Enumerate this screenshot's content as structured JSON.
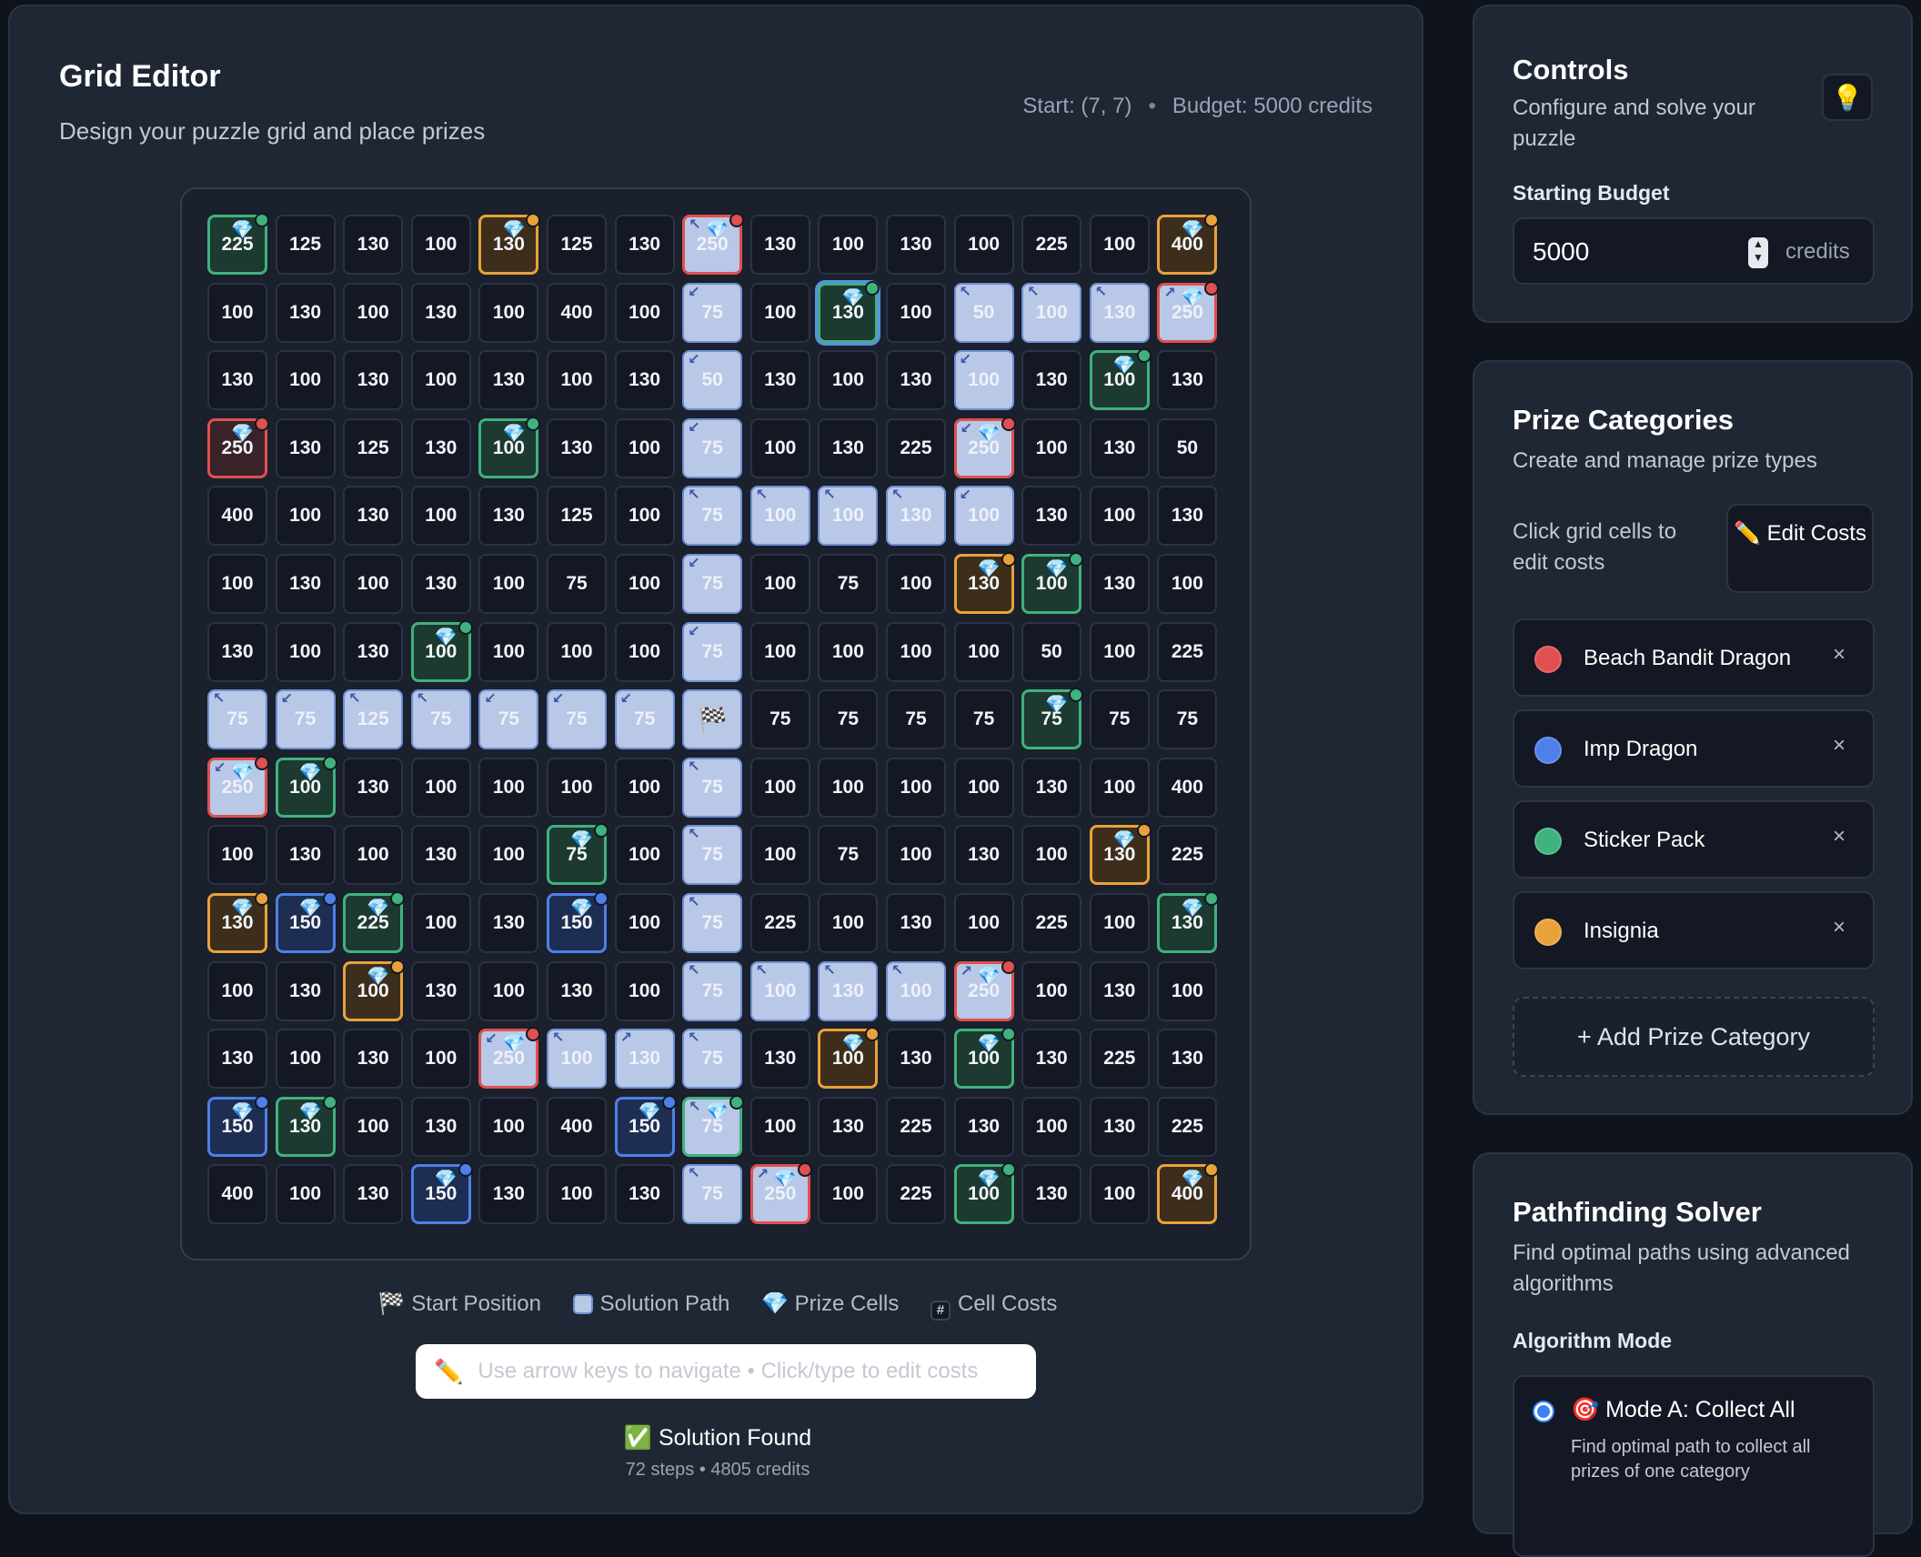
{
  "editor": {
    "title": "Grid Editor",
    "subtitle": "Design your puzzle grid and place prizes",
    "start_label": "Start: (7, 7)",
    "sep": "•",
    "budget_label": "Budget: 5000 credits"
  },
  "colors": {
    "red": "#e0504f",
    "blue": "#4f7fe8",
    "green": "#3fb27d",
    "orange": "#e9a23b",
    "path": "#b8c8e6"
  },
  "grid": {
    "rows": 15,
    "cols": 15,
    "start": [
      7,
      7
    ],
    "selected": [
      1,
      9
    ],
    "costs": [
      [
        "225",
        "125",
        "130",
        "100",
        "130",
        "125",
        "130",
        "250",
        "130",
        "100",
        "130",
        "100",
        "225",
        "100",
        "400"
      ],
      [
        "100",
        "130",
        "100",
        "130",
        "100",
        "400",
        "100",
        "75",
        "100",
        "130",
        "100",
        "50",
        "100",
        "130",
        "250"
      ],
      [
        "130",
        "100",
        "130",
        "100",
        "130",
        "100",
        "130",
        "50",
        "130",
        "100",
        "130",
        "100",
        "130",
        "100",
        "130"
      ],
      [
        "250",
        "130",
        "125",
        "130",
        "100",
        "130",
        "100",
        "75",
        "100",
        "130",
        "225",
        "250",
        "100",
        "130",
        "50"
      ],
      [
        "400",
        "100",
        "130",
        "100",
        "130",
        "125",
        "100",
        "75",
        "100",
        "100",
        "130",
        "100",
        "130",
        "100",
        "130"
      ],
      [
        "100",
        "130",
        "100",
        "130",
        "100",
        "75",
        "100",
        "75",
        "100",
        "75",
        "100",
        "130",
        "100",
        "130",
        "100"
      ],
      [
        "130",
        "100",
        "130",
        "100",
        "100",
        "100",
        "100",
        "75",
        "100",
        "100",
        "100",
        "100",
        "50",
        "100",
        "225"
      ],
      [
        "75",
        "75",
        "125",
        "75",
        "75",
        "75",
        "75",
        "",
        "75",
        "75",
        "75",
        "75",
        "75",
        "75",
        "75"
      ],
      [
        "250",
        "100",
        "130",
        "100",
        "100",
        "100",
        "100",
        "75",
        "100",
        "100",
        "100",
        "100",
        "130",
        "100",
        "400"
      ],
      [
        "100",
        "130",
        "100",
        "130",
        "100",
        "75",
        "100",
        "75",
        "100",
        "75",
        "100",
        "130",
        "100",
        "130",
        "225"
      ],
      [
        "130",
        "150",
        "225",
        "100",
        "130",
        "150",
        "100",
        "75",
        "225",
        "100",
        "130",
        "100",
        "225",
        "100",
        "130"
      ],
      [
        "100",
        "130",
        "100",
        "130",
        "100",
        "130",
        "100",
        "75",
        "100",
        "130",
        "100",
        "250",
        "100",
        "130",
        "100"
      ],
      [
        "130",
        "100",
        "130",
        "100",
        "250",
        "100",
        "130",
        "75",
        "130",
        "100",
        "130",
        "100",
        "130",
        "225",
        "130"
      ],
      [
        "150",
        "130",
        "100",
        "130",
        "100",
        "400",
        "150",
        "75",
        "100",
        "130",
        "225",
        "130",
        "100",
        "130",
        "225"
      ],
      [
        "400",
        "100",
        "130",
        "150",
        "130",
        "100",
        "130",
        "75",
        "250",
        "100",
        "225",
        "100",
        "130",
        "100",
        "400"
      ]
    ],
    "path": [
      [
        0,
        7,
        "↖"
      ],
      [
        1,
        7,
        "↙"
      ],
      [
        2,
        7,
        "↙"
      ],
      [
        3,
        7,
        "↙"
      ],
      [
        4,
        7,
        "↖"
      ],
      [
        5,
        7,
        "↙"
      ],
      [
        6,
        7,
        "↙"
      ],
      [
        8,
        7,
        "↖"
      ],
      [
        9,
        7,
        "↖"
      ],
      [
        10,
        7,
        "↖"
      ],
      [
        11,
        7,
        "↖"
      ],
      [
        12,
        7,
        "↖"
      ],
      [
        13,
        7,
        "↖"
      ],
      [
        14,
        7,
        "↖"
      ],
      [
        7,
        0,
        "↖"
      ],
      [
        7,
        1,
        "↙"
      ],
      [
        7,
        2,
        "↖"
      ],
      [
        7,
        3,
        "↖"
      ],
      [
        7,
        4,
        "↙"
      ],
      [
        7,
        5,
        "↙"
      ],
      [
        7,
        6,
        "↙"
      ],
      [
        8,
        0,
        "↙"
      ],
      [
        1,
        11,
        "↖"
      ],
      [
        1,
        12,
        "↖"
      ],
      [
        1,
        13,
        "↖"
      ],
      [
        1,
        14,
        "↗"
      ],
      [
        2,
        11,
        "↙"
      ],
      [
        3,
        11,
        "↙"
      ],
      [
        4,
        8,
        "↖"
      ],
      [
        4,
        9,
        "↖"
      ],
      [
        4,
        10,
        "↖"
      ],
      [
        4,
        11,
        "↙"
      ],
      [
        11,
        8,
        "↖"
      ],
      [
        11,
        9,
        "↖"
      ],
      [
        11,
        10,
        "↖"
      ],
      [
        11,
        11,
        "↗"
      ],
      [
        12,
        4,
        "↙"
      ],
      [
        12,
        5,
        "↖"
      ],
      [
        12,
        6,
        "↗"
      ],
      [
        14,
        8,
        "↗"
      ]
    ],
    "prizes": [
      [
        0,
        0,
        "green"
      ],
      [
        0,
        4,
        "orange"
      ],
      [
        0,
        7,
        "red"
      ],
      [
        0,
        14,
        "orange"
      ],
      [
        1,
        9,
        "green"
      ],
      [
        1,
        14,
        "red"
      ],
      [
        2,
        13,
        "green"
      ],
      [
        3,
        0,
        "red"
      ],
      [
        3,
        4,
        "green"
      ],
      [
        3,
        11,
        "red"
      ],
      [
        5,
        11,
        "orange"
      ],
      [
        5,
        12,
        "green"
      ],
      [
        6,
        3,
        "green"
      ],
      [
        7,
        12,
        "green"
      ],
      [
        8,
        0,
        "red"
      ],
      [
        8,
        1,
        "green"
      ],
      [
        9,
        5,
        "green"
      ],
      [
        9,
        13,
        "orange"
      ],
      [
        10,
        0,
        "orange"
      ],
      [
        10,
        1,
        "blue"
      ],
      [
        10,
        2,
        "green"
      ],
      [
        10,
        5,
        "blue"
      ],
      [
        10,
        14,
        "green"
      ],
      [
        11,
        2,
        "orange"
      ],
      [
        11,
        11,
        "red"
      ],
      [
        12,
        4,
        "red"
      ],
      [
        12,
        9,
        "orange"
      ],
      [
        12,
        11,
        "green"
      ],
      [
        13,
        0,
        "blue"
      ],
      [
        13,
        1,
        "green"
      ],
      [
        13,
        6,
        "blue"
      ],
      [
        13,
        7,
        "green"
      ],
      [
        14,
        3,
        "blue"
      ],
      [
        14,
        8,
        "red"
      ],
      [
        14,
        11,
        "green"
      ],
      [
        14,
        14,
        "orange"
      ]
    ],
    "gem_icon": "💎",
    "start_icon": "🏁"
  },
  "legend": {
    "start": "Start Position",
    "path": "Solution Path",
    "prize": "Prize Cells",
    "cost": "Cell Costs",
    "start_icon": "🏁",
    "prize_icon": "💎",
    "cost_icon": "#"
  },
  "hint": {
    "icon": "✏️",
    "placeholder": "Use arrow keys to navigate • Click/type to edit costs"
  },
  "solution": {
    "status": "✅ Solution Found",
    "details": "72 steps • 4805 credits"
  },
  "controls": {
    "title": "Controls",
    "subtitle": "Configure and solve your puzzle",
    "bulb_icon": "💡",
    "budget_label": "Starting Budget",
    "budget_value": "5000",
    "budget_unit": "credits"
  },
  "prizes_panel": {
    "title": "Prize Categories",
    "subtitle": "Create and manage prize types",
    "hint": "Click grid cells to edit costs",
    "edit_btn": "✏️ Edit Costs",
    "categories": [
      {
        "name": "Beach Bandit Dragon",
        "color": "#e0504f"
      },
      {
        "name": "Imp Dragon",
        "color": "#4f7fe8"
      },
      {
        "name": "Sticker Pack",
        "color": "#3fb27d"
      },
      {
        "name": "Insignia",
        "color": "#e9a23b"
      }
    ],
    "remove_icon": "×",
    "add_btn": "+ Add Prize Category"
  },
  "solver": {
    "title": "Pathfinding Solver",
    "subtitle": "Find optimal paths using advanced algorithms",
    "mode_label": "Algorithm Mode",
    "mode_a_title": "🎯 Mode A: Collect All",
    "mode_a_desc": "Find optimal path to collect all prizes of one category"
  }
}
